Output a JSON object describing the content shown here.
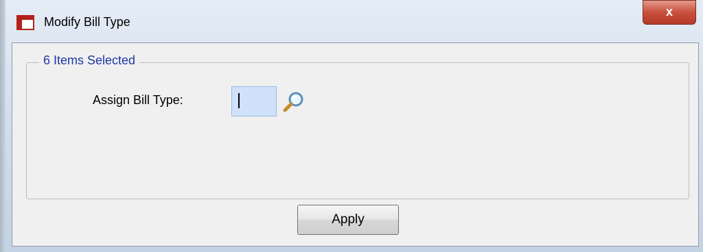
{
  "window": {
    "title": "Modify Bill Type",
    "close_label": "x"
  },
  "group": {
    "legend": "6 Items Selected"
  },
  "form": {
    "assign_label": "Assign Bill Type:",
    "bill_type_value": "",
    "lookup_icon": "magnifier-icon"
  },
  "actions": {
    "apply_label": "Apply"
  },
  "colors": {
    "legend_text": "#1f38a6",
    "input_background": "#cfe1fb",
    "close_button": "#c9503d"
  }
}
